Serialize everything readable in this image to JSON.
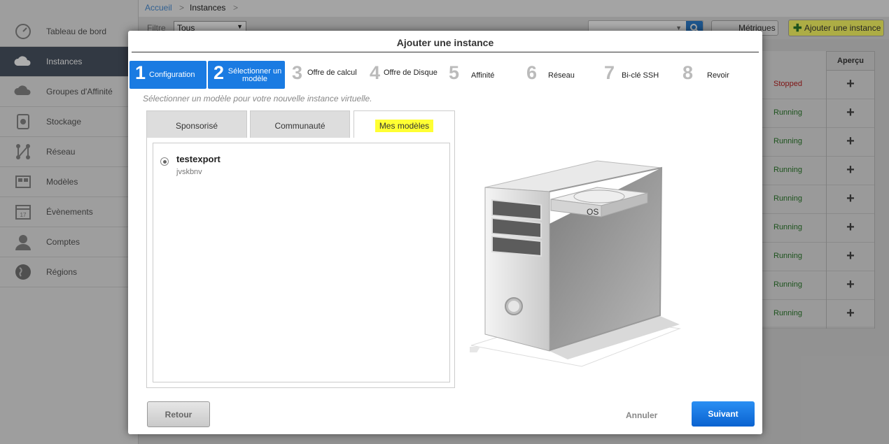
{
  "breadcrumb": {
    "home": "Accueil",
    "sep": ">",
    "current": "Instances"
  },
  "sidebar": {
    "items": [
      {
        "label": "Tableau de bord",
        "icon": "dashboard-icon"
      },
      {
        "label": "Instances",
        "icon": "cloud-icon",
        "active": true
      },
      {
        "label": "Groupes d'Affinité",
        "icon": "affinity-icon"
      },
      {
        "label": "Stockage",
        "icon": "storage-icon"
      },
      {
        "label": "Réseau",
        "icon": "network-icon"
      },
      {
        "label": "Modèles",
        "icon": "templates-icon"
      },
      {
        "label": "Évènements",
        "icon": "calendar-icon"
      },
      {
        "label": "Comptes",
        "icon": "user-icon"
      },
      {
        "label": "Régions",
        "icon": "globe-icon"
      }
    ]
  },
  "toolbar": {
    "filter_label": "Filtre",
    "filter_value": "Tous",
    "metrics_label": "Métriques",
    "add_instance_label": "Ajouter une instance"
  },
  "table": {
    "preview_header": "Aperçu",
    "rows": [
      {
        "state": "Stopped"
      },
      {
        "state": "Running"
      },
      {
        "state": "Running"
      },
      {
        "state": "Running"
      },
      {
        "state": "Running"
      },
      {
        "state": "Running"
      },
      {
        "state": "Running"
      },
      {
        "state": "Running"
      },
      {
        "state": "Running"
      }
    ],
    "preview_symbol": "+"
  },
  "dialog": {
    "title": "Ajouter une instance",
    "steps": [
      {
        "num": "1",
        "label": "Configuration"
      },
      {
        "num": "2",
        "label": "Sélectionner un modèle"
      },
      {
        "num": "3",
        "label": "Offre de calcul"
      },
      {
        "num": "4",
        "label": "Offre de Disque"
      },
      {
        "num": "5",
        "label": "Affinité"
      },
      {
        "num": "6",
        "label": "Réseau"
      },
      {
        "num": "7",
        "label": "Bi-clé SSH"
      },
      {
        "num": "8",
        "label": "Revoir"
      }
    ],
    "hint": "Sélectionner un modèle pour votre nouvelle instance virtuelle.",
    "tabs": [
      "Sponsorisé",
      "Communauté",
      "Mes modèles"
    ],
    "template": {
      "name": "testexport",
      "description": "jvskbnv",
      "selected": true
    },
    "illustration_label": "OS",
    "back_label": "Retour",
    "cancel_label": "Annuler",
    "next_label": "Suivant"
  },
  "colors": {
    "primary": "#1a7be2",
    "highlight": "#ffff33",
    "sidebar_active": "#4a5563"
  }
}
